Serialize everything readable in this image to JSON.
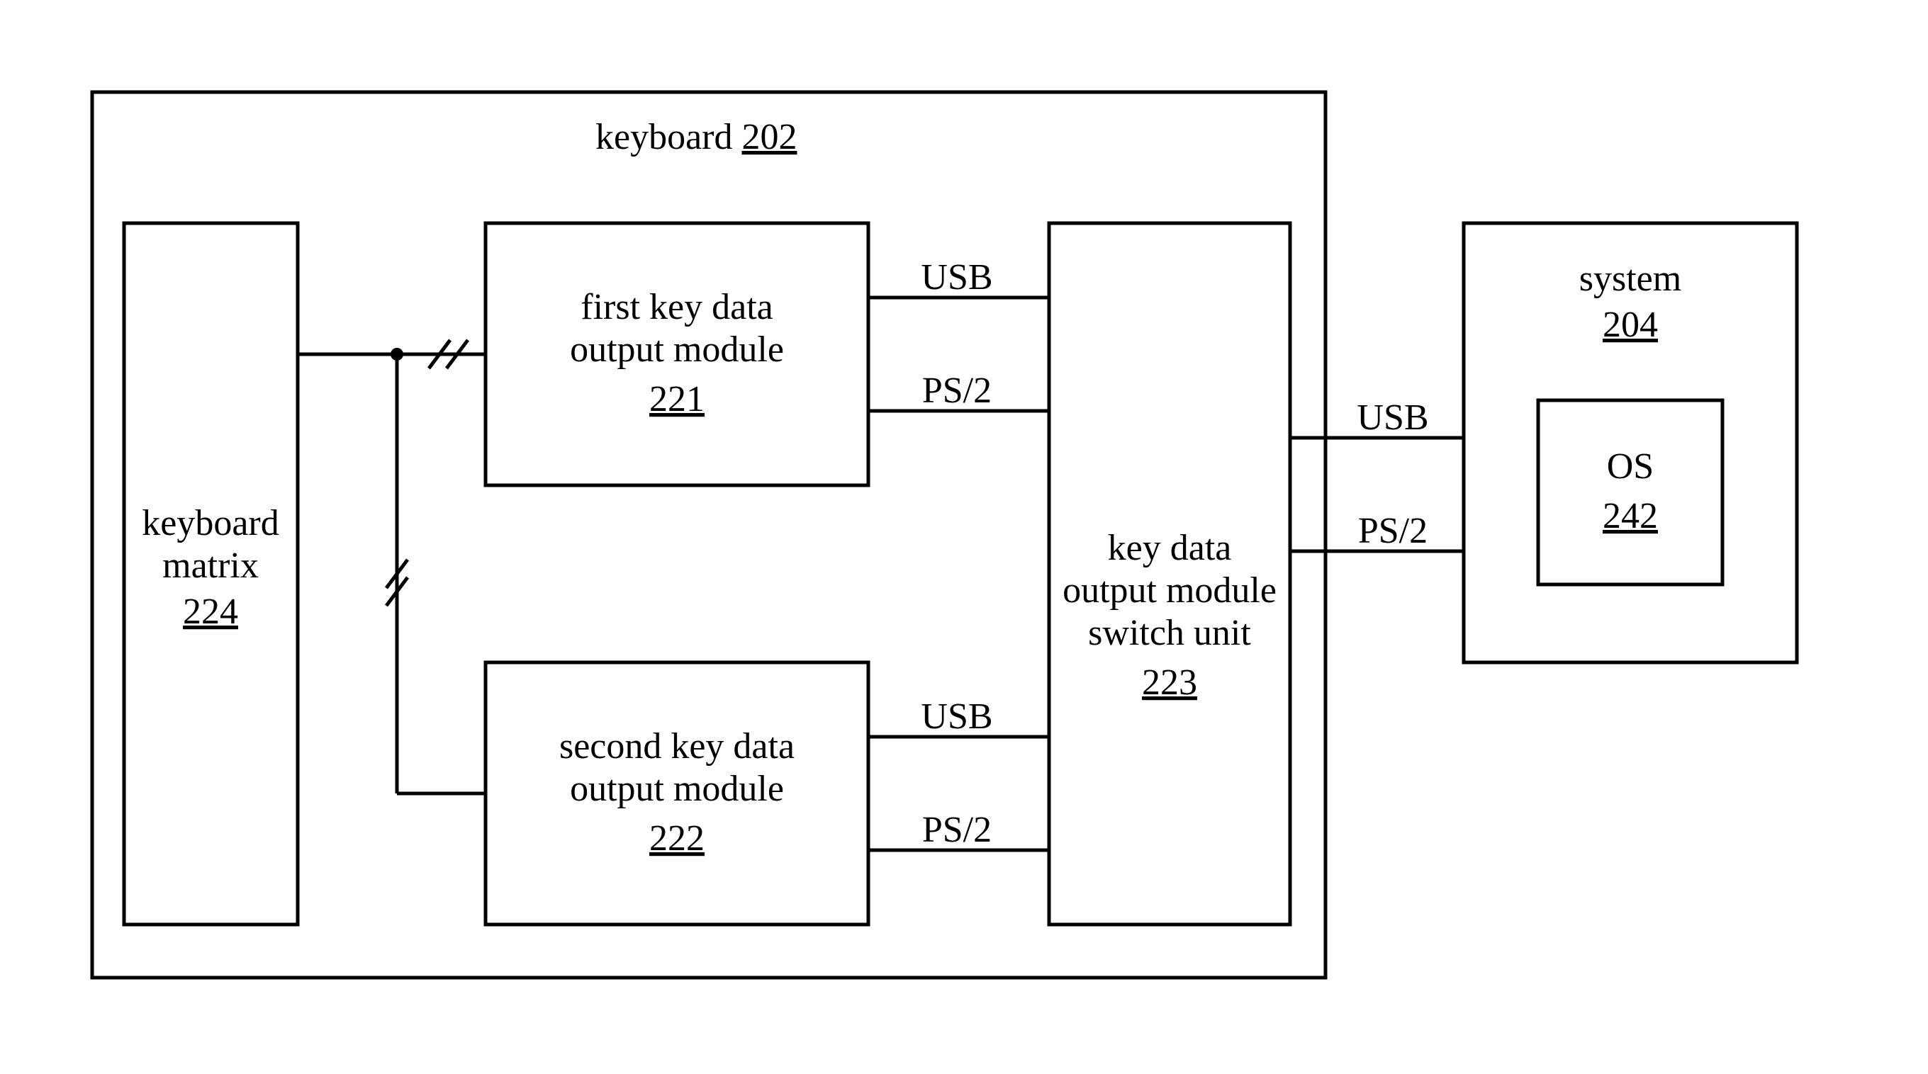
{
  "keyboard": {
    "label": "keyboard",
    "ref": "202"
  },
  "matrix": {
    "label1": "keyboard",
    "label2": "matrix",
    "ref": "224"
  },
  "mod1": {
    "label1": "first key data",
    "label2": "output module",
    "ref": "221"
  },
  "mod2": {
    "label1": "second key data",
    "label2": "output module",
    "ref": "222"
  },
  "switch": {
    "label1": "key data",
    "label2": "output module",
    "label3": "switch unit",
    "ref": "223"
  },
  "system": {
    "label": "system",
    "ref": "204"
  },
  "os": {
    "label": "OS",
    "ref": "242"
  },
  "conn": {
    "usb": "USB",
    "ps2": "PS/2"
  }
}
